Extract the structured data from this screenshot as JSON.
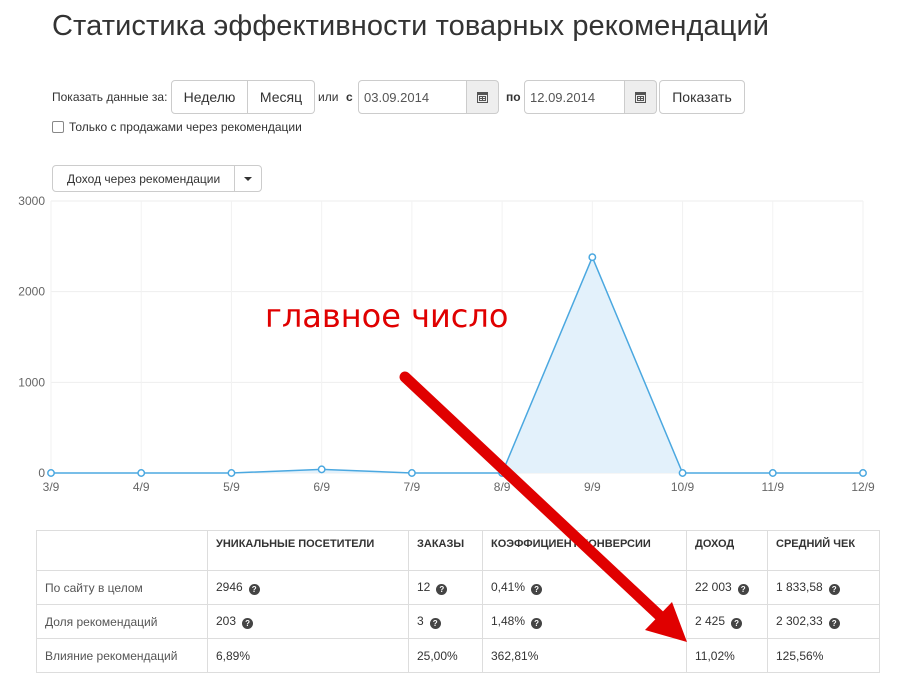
{
  "page": {
    "title": "Статистика эффективности товарных рекомендаций"
  },
  "filters": {
    "show_label": "Показать данные за:",
    "week_label": "Неделю",
    "month_label": "Месяц",
    "or_label": "или",
    "from_label": "с",
    "from_date": "03.09.2014",
    "to_label": "по",
    "to_date": "12.09.2014",
    "show_button": "Показать",
    "only_sales_label": "Только с продажами через рекомендации",
    "only_sales_checked": false
  },
  "metric_select": {
    "selected": "Доход через рекомендации"
  },
  "chart_data": {
    "type": "area",
    "categories": [
      "3/9",
      "4/9",
      "5/9",
      "6/9",
      "7/9",
      "8/9",
      "9/9",
      "10/9",
      "11/9",
      "12/9"
    ],
    "values": [
      0,
      0,
      0,
      40,
      0,
      0,
      2380,
      0,
      0,
      0
    ],
    "ylim": [
      0,
      3000
    ],
    "yticks": [
      0,
      1000,
      2000,
      3000
    ],
    "grid": true,
    "color": "#4ba8e0",
    "fill": "#e3f1fb"
  },
  "annotation": {
    "text": "главное число",
    "color": "#e00000"
  },
  "table": {
    "headers": [
      "",
      "Уникальные посетители",
      "Заказы",
      "Коэффициент конверсии",
      "Доход",
      "Средний чек"
    ],
    "rows": [
      {
        "label": "По сайту в целом",
        "cells": [
          "2946",
          "12",
          "0,41%",
          "22 003",
          "1 833,58"
        ],
        "help": [
          true,
          true,
          true,
          true,
          true
        ]
      },
      {
        "label": "Доля рекомендаций",
        "cells": [
          "203",
          "3",
          "1,48%",
          "2 425",
          "2 302,33"
        ],
        "help": [
          true,
          true,
          true,
          true,
          true
        ]
      },
      {
        "label": "Влияние рекомендаций",
        "cells": [
          "6,89%",
          "25,00%",
          "362,81%",
          "11,02%",
          "125,56%"
        ],
        "help": [
          false,
          false,
          false,
          false,
          false
        ]
      }
    ]
  }
}
